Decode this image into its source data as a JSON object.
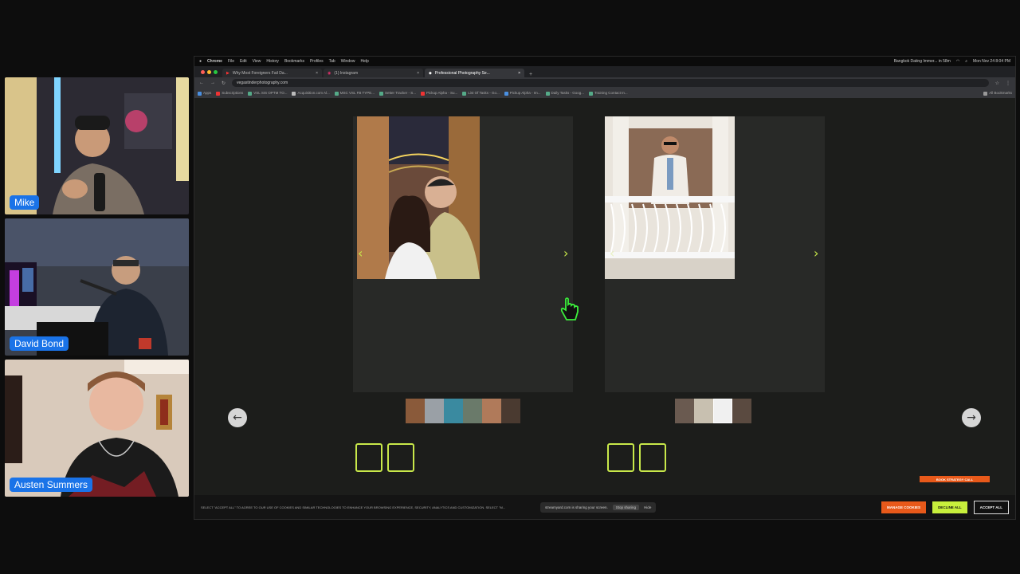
{
  "participants": [
    {
      "name": "Mike"
    },
    {
      "name": "David Bond"
    },
    {
      "name": "Austen Summers"
    }
  ],
  "os_menubar": {
    "app": "Chrome",
    "items": [
      "File",
      "Edit",
      "View",
      "History",
      "Bookmarks",
      "Profiles",
      "Tab",
      "Window",
      "Help"
    ],
    "now_playing": "Bangkok Dating Immer... in 58m",
    "datetime": "Mon Nov 24 8:04 PM"
  },
  "browser": {
    "tabs": [
      {
        "title": "Why Most Foreigners Fail Da..."
      },
      {
        "title": "(1) Instagram"
      },
      {
        "title": "Professional Photography Se...",
        "active": true
      }
    ],
    "url": "vegastinderphotography.com",
    "bookmarks": [
      "Apps",
      "Subscriptions",
      "VSL SIS OPTM TO...",
      "Acquisition.com Al...",
      "MSC VSL FB TYPE...",
      "Setter Tracker - S...",
      "Pickup Alpha - Su...",
      "List Of Tasks - Go...",
      "Pickup Alpha - Im...",
      "Daily Tasks - Goog...",
      "Training Contact In...",
      "All Bookmarks"
    ]
  },
  "page": {
    "book_call_label": "BOOK STRATEGY CALL",
    "cookie_text": "SELECT \"ACCEPT ALL\" TO AGREE TO OUR USE OF COOKIES AND SIMILAR TECHNOLOGIES TO ENHANCE YOUR BROWSING EXPERIENCE, SECURITY, ANALYTICS AND CUSTOMIZATION. SELECT \"M...",
    "manage_cookies": "MANAGE COOKIES",
    "decline_all": "DECLINE ALL",
    "accept_all": "ACCEPT ALL",
    "left_arrow": "←",
    "right_arrow": "→",
    "carousel_prev": "‹",
    "carousel_next": "›"
  },
  "screen_share": {
    "message": "streamyard.com is sharing your screen.",
    "stop_label": "Stop sharing",
    "hide_label": "Hide"
  },
  "colors": {
    "accent_lime": "#c8e84a",
    "cookie_orange": "#e8591a",
    "participant_tag": "#1a73e8"
  }
}
